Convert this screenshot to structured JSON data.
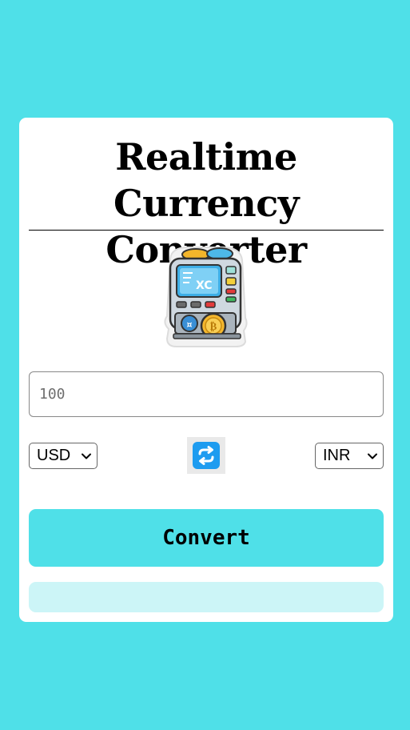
{
  "app": {
    "title": "Realtime Currency Converter"
  },
  "amount": {
    "value": "",
    "placeholder": "100"
  },
  "from_currency": {
    "selected": "USD"
  },
  "to_currency": {
    "selected": "INR"
  },
  "convert_button": {
    "label": "Convert"
  },
  "result": {
    "text": ""
  },
  "logo": {
    "screen_text": "XC"
  },
  "colors": {
    "background": "#4fe0e8",
    "button": "#4fe0e8",
    "result_bg": "#ccf5f7",
    "swap_icon": "#1e9cf0"
  }
}
